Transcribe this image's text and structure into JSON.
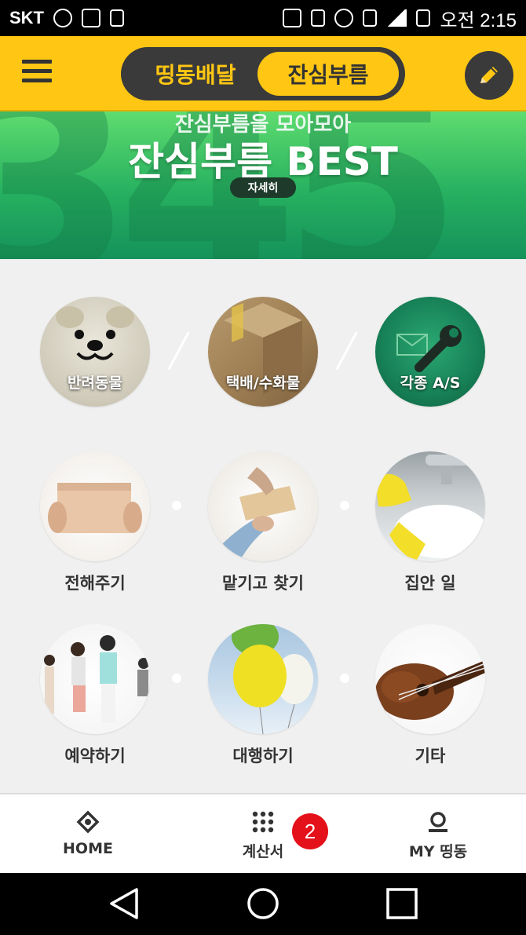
{
  "status_bar": {
    "carrier": "SKT",
    "time": "오전 2:15",
    "icons": [
      "alarm-icon",
      "image-icon",
      "battery-saver-icon",
      "nfc-icon",
      "vibrate-icon",
      "alarm-clock-icon",
      "lte-icon",
      "signal-icon",
      "battery-icon"
    ]
  },
  "header": {
    "tab_left": "띵동배달",
    "tab_right": "잔심부름",
    "active_tab": "잔심부름",
    "accent_color": "#ffc713"
  },
  "banner": {
    "subtitle": "잔심부름을 모아모아",
    "title": "잔심부름 BEST",
    "button": "자세히",
    "background_number": "345"
  },
  "categories": [
    {
      "label": "반려동물",
      "icon": "puppy-icon",
      "label_inside": true
    },
    {
      "label": "택배/수화물",
      "icon": "box-icon",
      "label_inside": true
    },
    {
      "label": "각종 A/S",
      "icon": "wrench-icon",
      "label_inside": true
    },
    {
      "label": "전해주기",
      "icon": "handing-box-icon",
      "label_inside": false
    },
    {
      "label": "맡기고 찾기",
      "icon": "envelope-handoff-icon",
      "label_inside": false
    },
    {
      "label": "집안 일",
      "icon": "dishwashing-icon",
      "label_inside": false
    },
    {
      "label": "예약하기",
      "icon": "people-queue-icon",
      "label_inside": false
    },
    {
      "label": "대행하기",
      "icon": "balloons-icon",
      "label_inside": false
    },
    {
      "label": "기타",
      "icon": "ukulele-icon",
      "label_inside": false
    }
  ],
  "bottom_nav": {
    "home": "HOME",
    "bill": "계산서",
    "bill_badge": "2",
    "my": "MY 띵동"
  },
  "system_nav": [
    "back-icon",
    "home-circle-icon",
    "recents-icon"
  ]
}
